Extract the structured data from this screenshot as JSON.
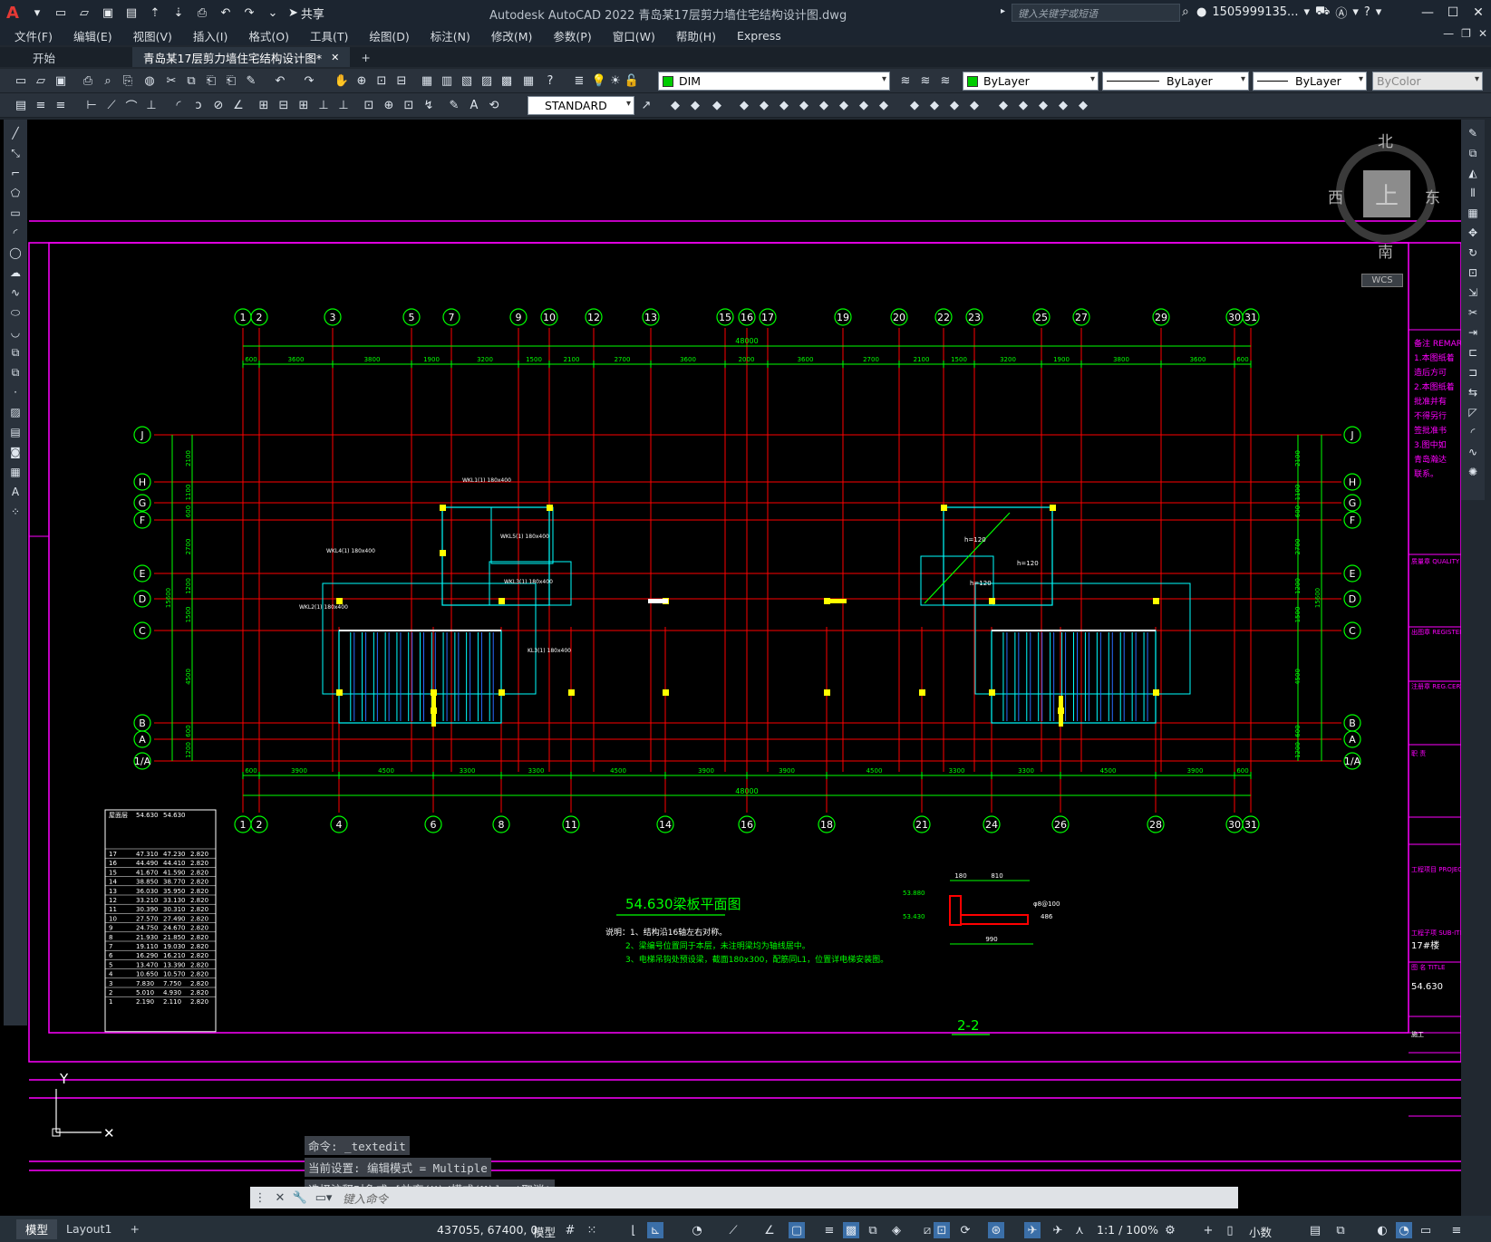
{
  "titlebar": {
    "app_logo": "A",
    "share_label": "共享",
    "window_title": "Autodesk AutoCAD 2022    青岛某17层剪力墙住宅结构设计图.dwg",
    "search_placeholder": "键入关键字或短语",
    "user_name": "1505999135...",
    "controls": [
      "—",
      "☐",
      "✕"
    ]
  },
  "menu": {
    "items": [
      "文件(F)",
      "编辑(E)",
      "视图(V)",
      "插入(I)",
      "格式(O)",
      "工具(T)",
      "绘图(D)",
      "标注(N)",
      "修改(M)",
      "参数(P)",
      "窗口(W)",
      "帮助(H)",
      "Express"
    ]
  },
  "tabs": {
    "start": "开始",
    "drawing": "青岛某17层剪力墙住宅结构设计图*",
    "close": "✕",
    "add": "+"
  },
  "toolbar": {
    "layer_combo": "DIM",
    "color_combo": "ByLayer",
    "linetype_combo": "ByLayer",
    "lineweight_combo": "ByLayer",
    "plotstyle_combo": "ByColor",
    "textstyle_combo": "STANDARD"
  },
  "viewcube": {
    "north": "北",
    "south": "南",
    "east": "东",
    "west": "西",
    "top": "上",
    "wcs": "WCS"
  },
  "drawing": {
    "top_axes": [
      "1",
      "2",
      "3",
      "5",
      "7",
      "9",
      "10",
      "12",
      "13",
      "15",
      "16",
      "17",
      "19",
      "20",
      "22",
      "23",
      "25",
      "27",
      "29",
      "30",
      "31"
    ],
    "bottom_axes": [
      "1",
      "2",
      "4",
      "6",
      "8",
      "11",
      "14",
      "16",
      "18",
      "21",
      "24",
      "26",
      "28",
      "30",
      "31"
    ],
    "row_axes": [
      "J",
      "H",
      "G",
      "F",
      "E",
      "D",
      "C",
      "B",
      "A",
      "1/A"
    ],
    "overall_dim": "48000",
    "top_dims": [
      "600",
      "3600",
      "3800",
      "1900",
      "3200",
      "1500",
      "2100",
      "2700",
      "3600",
      "2000",
      "3600",
      "2700",
      "2100",
      "1500",
      "3200",
      "1900",
      "3800",
      "3600",
      "600"
    ],
    "bottom_dims": [
      "600",
      "3900",
      "4500",
      "3300",
      "3300",
      "4500",
      "3900",
      "3900",
      "4500",
      "3300",
      "3300",
      "4500",
      "3900",
      "600"
    ],
    "left_dims": [
      "2100",
      "1100",
      "600",
      "2700",
      "1200",
      "1500",
      "4500",
      "600",
      "1200"
    ],
    "left_total": "15600",
    "plan_title": "54.630梁板平面图",
    "notes": [
      "说明：1、结构沿16轴左右对称。",
      "2、梁编号位置同于本层，未注明梁均为轴线居中。",
      "3、电梯吊钩处预设梁，截面180x300，配筋同L1，位置详电梯安装图。"
    ],
    "section_title": "2-2",
    "section_dims": [
      "180",
      "810",
      "990",
      "486"
    ],
    "section_levels": [
      "53.880",
      "53.430"
    ],
    "section_note": "φ8@100",
    "beam_labels": [
      "WKL4(1) 180x400",
      "WKL1(1) 180x400",
      "WKL5(1) 180x400",
      "WKL3(1) 180x400",
      "WKL2(1) 180x400",
      "KL3(1) 180x400"
    ],
    "slab_labels": [
      "h=120",
      "h=120",
      "h=120"
    ],
    "remark_lines": [
      "备注 REMARK",
      "1.本图纸着",
      "造后方可",
      "2.本图纸着",
      "批准并有",
      "不得另行",
      "签批准书",
      "3.图中如",
      "青岛瀚达",
      "联系。"
    ],
    "titleblock": [
      "质量章 QUALITY SEAL",
      "出图章 REGISTERED",
      "注册章 REG.CERT",
      "职 责",
      "工程项目 PROJECT",
      "工程子项 SUB-ITEM",
      "17#楼",
      "图 名 TITLE",
      "54.630",
      "施工"
    ]
  },
  "level_table": {
    "header": [
      "屋面层",
      "54.630",
      "54.630"
    ],
    "rows": [
      [
        "17",
        "47.310",
        "47.230",
        "2.820"
      ],
      [
        "16",
        "44.490",
        "44.410",
        "2.820"
      ],
      [
        "15",
        "41.670",
        "41.590",
        "2.820"
      ],
      [
        "14",
        "38.850",
        "38.770",
        "2.820"
      ],
      [
        "13",
        "36.030",
        "35.950",
        "2.820"
      ],
      [
        "12",
        "33.210",
        "33.130",
        "2.820"
      ],
      [
        "11",
        "30.390",
        "30.310",
        "2.820"
      ],
      [
        "10",
        "27.570",
        "27.490",
        "2.820"
      ],
      [
        "9",
        "24.750",
        "24.670",
        "2.820"
      ],
      [
        "8",
        "21.930",
        "21.850",
        "2.820"
      ],
      [
        "7",
        "19.110",
        "19.030",
        "2.820"
      ],
      [
        "6",
        "16.290",
        "16.210",
        "2.820"
      ],
      [
        "5",
        "13.470",
        "13.390",
        "2.820"
      ],
      [
        "4",
        "10.650",
        "10.570",
        "2.820"
      ],
      [
        "3",
        "7.830",
        "7.750",
        "2.820"
      ],
      [
        "2",
        "5.010",
        "4.930",
        "2.820"
      ],
      [
        "1",
        "2.190",
        "2.110",
        "2.820"
      ]
    ]
  },
  "command": {
    "history": [
      "命令: _textedit",
      "当前设置: 编辑模式 = Multiple",
      "选择注释对象或 [放弃(U)/模式(M)]: *取消*"
    ],
    "prompt": "键入命令"
  },
  "status": {
    "model_tab": "模型",
    "layout_tab": "Layout1",
    "add_tab": "+",
    "coords": "437055, 67400, 0",
    "mode": "模型",
    "scale": "1:1 / 100%",
    "units": "小数"
  },
  "colors": {
    "canvas": "#000000",
    "axis_line": "#ff0000",
    "dim": "#00ff00",
    "beam": "#00ffff",
    "frame": "#ff00ff",
    "column": "#ffff00"
  }
}
